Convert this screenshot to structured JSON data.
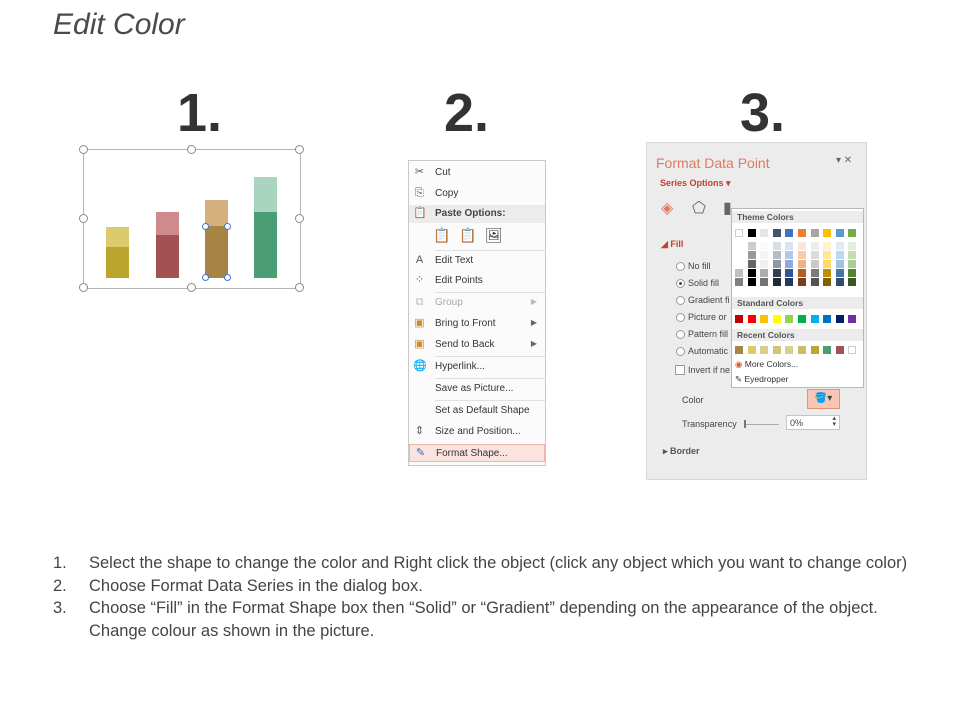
{
  "title": "Edit Color",
  "steps_numbers": [
    "1.",
    "2.",
    "3."
  ],
  "chart_panel": {
    "bar_colors": [
      [
        "#dccb6e",
        "#bca52c"
      ],
      [
        "#cf8b8b",
        "#a45151"
      ],
      [
        "#d3b07d",
        "#a88444"
      ],
      [
        "#a9d4bf",
        "#4b9e74"
      ]
    ]
  },
  "context_menu": {
    "items": [
      {
        "label": "Cut",
        "icon": "scissors-icon"
      },
      {
        "label": "Copy",
        "icon": "copy-icon"
      },
      {
        "label": "Paste Options:",
        "icon": "paste-icon"
      },
      {
        "label": "Edit Text",
        "icon": "edit-text-icon"
      },
      {
        "label": "Edit Points",
        "icon": "edit-points-icon"
      },
      {
        "label": "Group",
        "icon": "group-icon"
      },
      {
        "label": "Bring to Front",
        "icon": "bring-front-icon"
      },
      {
        "label": "Send to Back",
        "icon": "send-back-icon"
      },
      {
        "label": "Hyperlink...",
        "icon": "hyperlink-icon"
      },
      {
        "label": "Save as Picture...",
        "icon": ""
      },
      {
        "label": "Set as Default Shape",
        "icon": ""
      },
      {
        "label": "Size and Position...",
        "icon": "size-position-icon"
      },
      {
        "label": "Format Shape...",
        "icon": "format-shape-icon"
      }
    ]
  },
  "format_pane": {
    "title": "Format Data Point",
    "series_options": "Series Options",
    "fill_header": "Fill",
    "options": [
      "No fill",
      "Solid fill",
      "Gradient fi",
      "Picture or",
      "Pattern fill",
      "Automatic"
    ],
    "invert": "Invert if ne",
    "color_label": "Color",
    "transparency_label": "Transparency",
    "transparency_value": "0%",
    "border_label": "Border",
    "accent": "#e07a5f"
  },
  "color_picker": {
    "theme_header": "Theme Colors",
    "standard_header": "Standard Colors",
    "recent_header": "Recent Colors",
    "more_colors": "More Colors...",
    "eyedropper": "Eyedropper",
    "theme_top": [
      "#ffffff",
      "#000000",
      "#e7e6e6",
      "#44546a",
      "#4472c4",
      "#ed7d31",
      "#a5a5a5",
      "#ffc000",
      "#5b9bd5",
      "#70ad47"
    ],
    "standard": [
      "#c00000",
      "#ff0000",
      "#ffc000",
      "#ffff00",
      "#92d050",
      "#00b050",
      "#00b0f0",
      "#0070c0",
      "#002060",
      "#7030a0"
    ],
    "recent": [
      "#a88444",
      "#dccb6e",
      "#d9cf8a",
      "#cfc47a",
      "#d7d091",
      "#c9bd6c",
      "#bca52c",
      "#4b9e74",
      "#a45151",
      "#ffffff"
    ]
  },
  "instructions": [
    {
      "num": "1.",
      "text": "Select the shape to change the color and Right click the object (click any object which you want to change color)"
    },
    {
      "num": "2.",
      "text": "Choose Format Data Series in the dialog box."
    },
    {
      "num": "3.",
      "text": "Choose “Fill” in the Format Shape box then “Solid” or “Gradient” depending on the appearance of the object. Change colour as shown in the picture."
    }
  ]
}
